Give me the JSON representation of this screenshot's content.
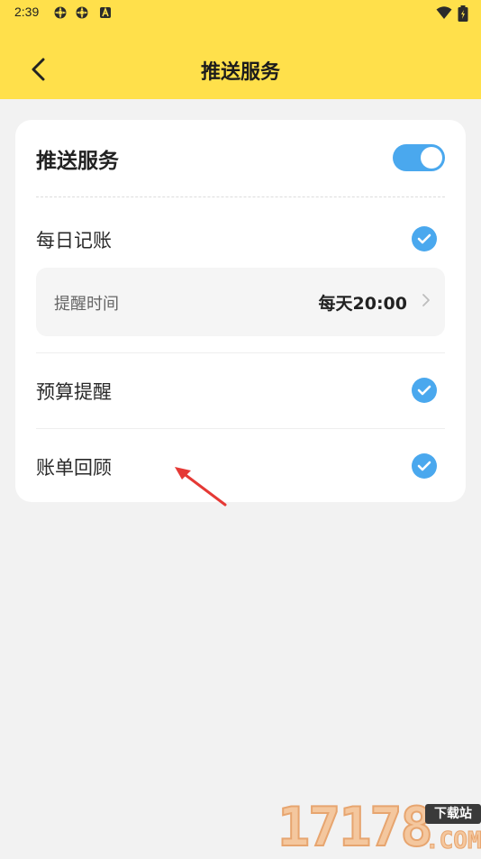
{
  "status_bar": {
    "time": "2:39",
    "left_icons": [
      "app-notification-icon",
      "app-notification-icon",
      "a-notification-icon"
    ],
    "right_icons": [
      "wifi-icon",
      "battery-icon"
    ]
  },
  "nav": {
    "title": "推送服务",
    "back_icon": "chevron-left-icon"
  },
  "card": {
    "header_label": "推送服务",
    "toggle_on": true,
    "items": [
      {
        "label": "每日记账",
        "checked": true
      },
      {
        "label": "预算提醒",
        "checked": true
      },
      {
        "label": "账单回顾",
        "checked": true
      }
    ],
    "reminder": {
      "label": "提醒时间",
      "value": "每天20:00"
    }
  },
  "watermark": {
    "number": "17178",
    "tag": "下载站",
    "suffix": ".COM"
  },
  "colors": {
    "header_bg": "#ffe04b",
    "accent": "#4aa8ee",
    "page_bg": "#f2f2f2",
    "arrow": "#e53935"
  }
}
